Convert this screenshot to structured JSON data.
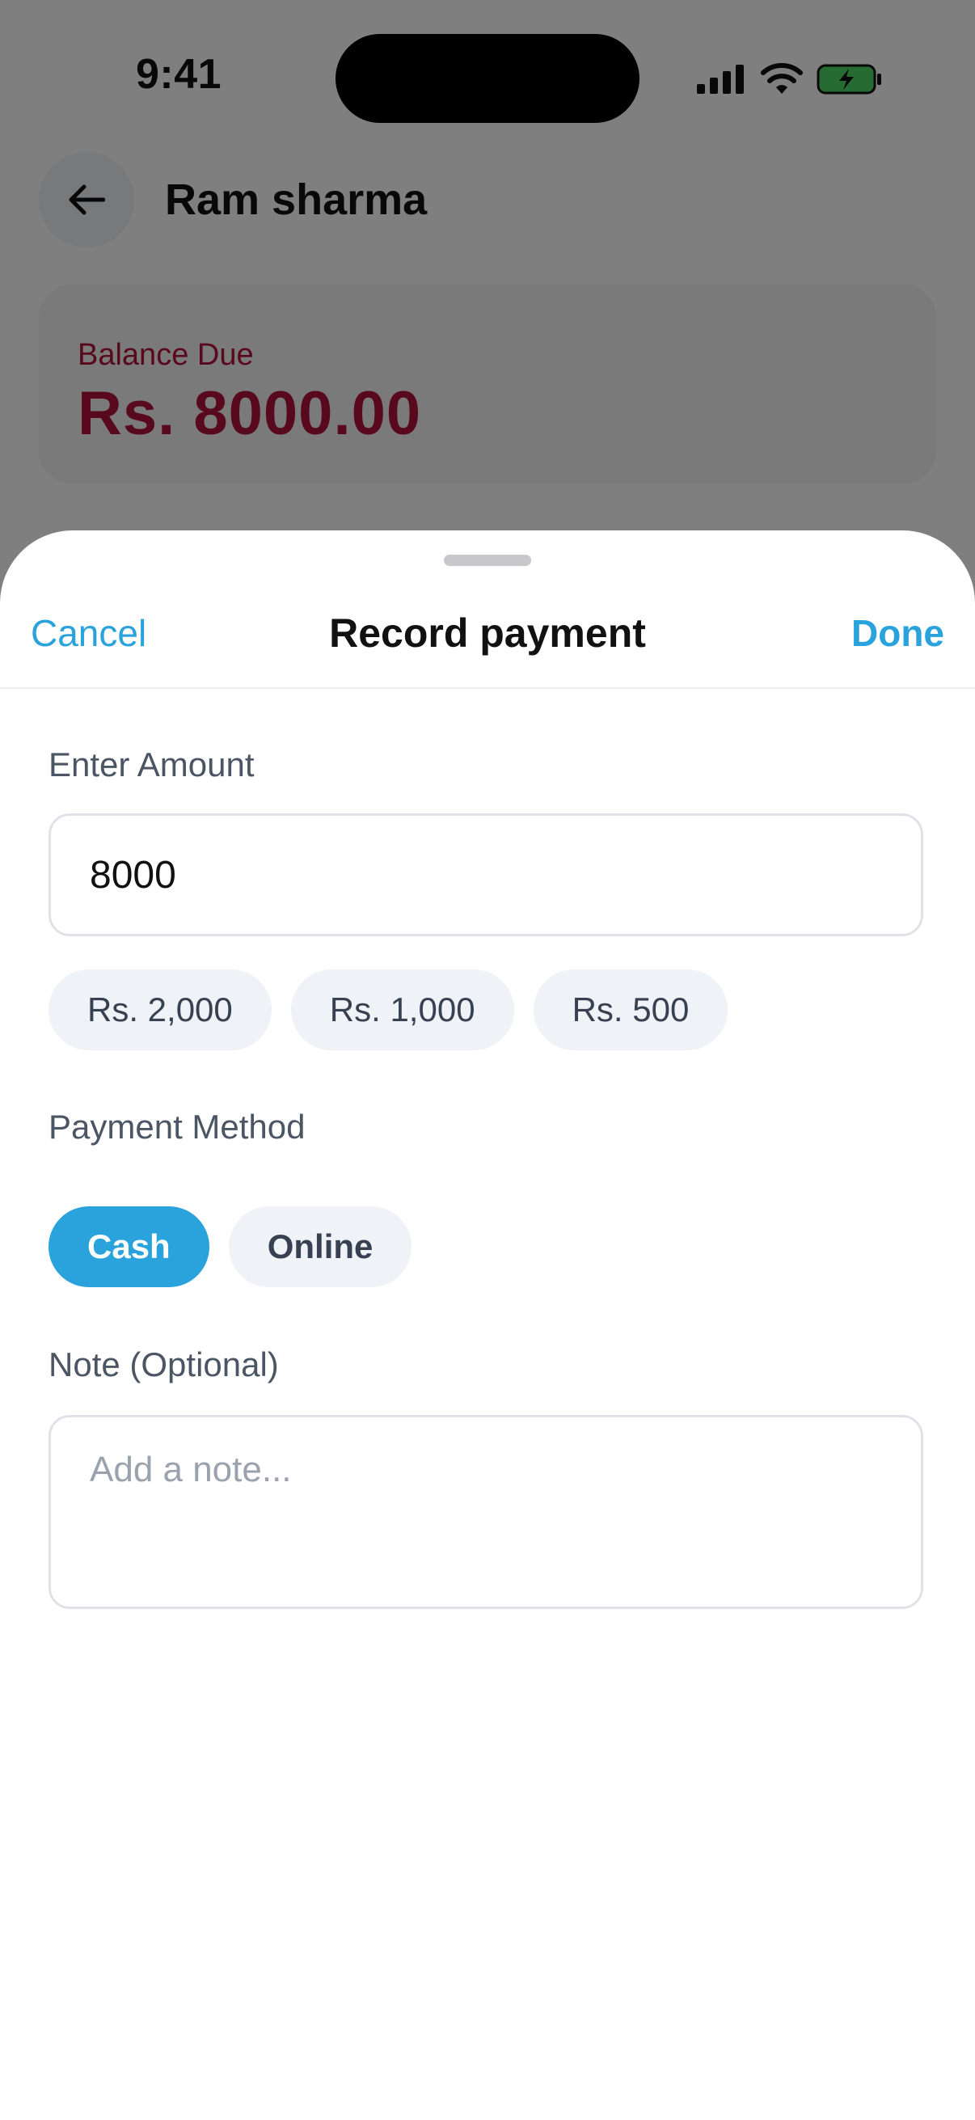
{
  "status_bar": {
    "time": "9:41"
  },
  "header": {
    "back_icon": "arrow-left-icon",
    "title": "Ram sharma"
  },
  "balance": {
    "label": "Balance Due",
    "amount": "Rs. 8000.00",
    "color": "#b3123a"
  },
  "sheet": {
    "cancel_label": "Cancel",
    "title": "Record payment",
    "done_label": "Done",
    "amount_label": "Enter Amount",
    "amount_value": "8000",
    "quick_amounts": [
      "Rs. 2,000",
      "Rs. 1,000",
      "Rs. 500"
    ],
    "method_label": "Payment Method",
    "methods": [
      "Cash",
      "Online"
    ],
    "selected_method": "Cash",
    "note_label": "Note (Optional)",
    "note_placeholder": "Add a note..."
  },
  "colors": {
    "accent": "#2aa3dd",
    "danger": "#b3123a"
  }
}
